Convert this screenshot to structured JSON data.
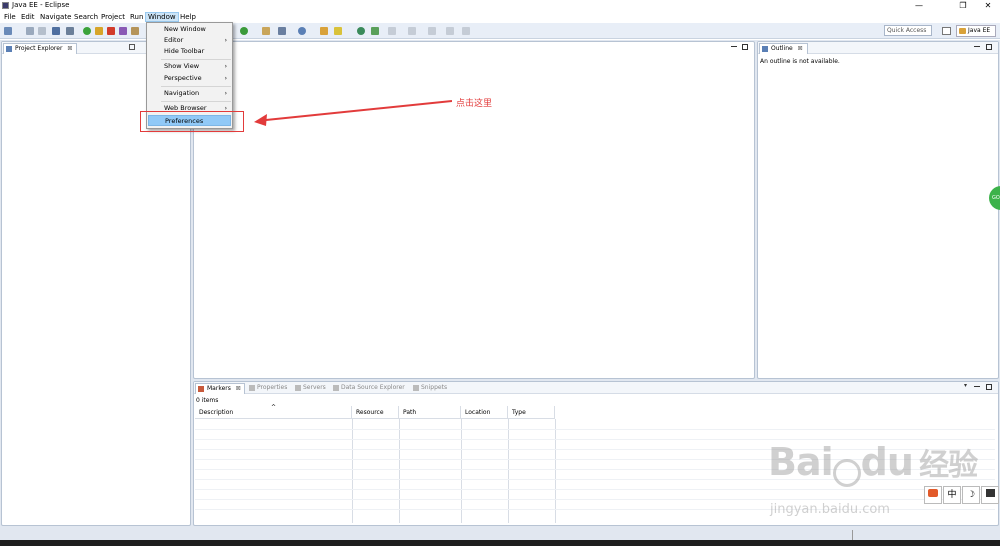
{
  "window": {
    "title": "Java EE - Eclipse"
  },
  "menubar": [
    "File",
    "Edit",
    "Navigate",
    "Search",
    "Project",
    "Run",
    "Window",
    "Help"
  ],
  "toolbar": {
    "quick_access": "Quick Access",
    "perspective": "Java EE"
  },
  "window_menu": {
    "items": [
      {
        "label": "New Window",
        "submenu": false
      },
      {
        "label": "Editor",
        "submenu": true
      },
      {
        "label": "Hide Toolbar",
        "submenu": false
      },
      {
        "label": "Show View",
        "submenu": true
      },
      {
        "label": "Perspective",
        "submenu": true
      },
      {
        "label": "Navigation",
        "submenu": true
      },
      {
        "label": "Web Browser",
        "submenu": true
      },
      {
        "label": "Preferences",
        "submenu": false,
        "selected": true
      }
    ]
  },
  "project_explorer": {
    "title": "Project Explorer"
  },
  "outline": {
    "title": "Outline",
    "message": "An outline is not available."
  },
  "bottom_panel": {
    "tabs": [
      "Markers",
      "Properties",
      "Servers",
      "Data Source Explorer",
      "Snippets"
    ],
    "count_text": "0 items",
    "columns": [
      "Description",
      "Resource",
      "Path",
      "Location",
      "Type"
    ]
  },
  "annotation": {
    "text": "点击这里",
    "color": "#e23b3b"
  },
  "watermark": {
    "main": "Bai",
    "main2": "du",
    "cn": "经验",
    "url": "jingyan.baidu.com"
  },
  "ime": [
    "中",
    "☽"
  ],
  "colors": {
    "accent": "#91c9f7",
    "annotation": "#e23b3b",
    "chrome": "#e1e7f0"
  }
}
